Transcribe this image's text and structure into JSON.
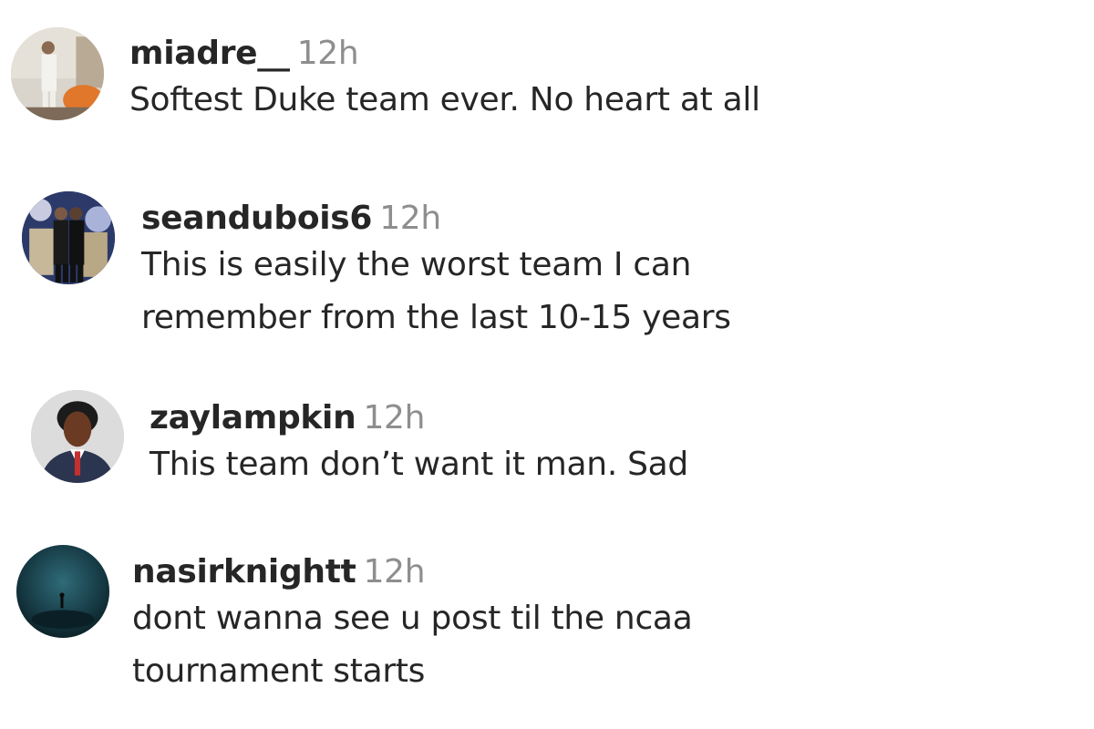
{
  "comments": [
    {
      "username": "miadre__",
      "time": "12h",
      "text": "Softest Duke team ever. No heart at all",
      "avatar_icon": "profile-photo"
    },
    {
      "username": "seandubois6",
      "time": "12h",
      "text": "This is easily the worst team I can remember from the last 10-15 years",
      "avatar_icon": "profile-photo"
    },
    {
      "username": "zaylampkin",
      "time": "12h",
      "text": "This team don’t want it man. Sad",
      "avatar_icon": "profile-photo"
    },
    {
      "username": "nasirknightt",
      "time": "12h",
      "text": "dont wanna see u post til the ncaa tournament starts",
      "avatar_icon": "profile-photo"
    }
  ],
  "colors": {
    "username": "#262626",
    "time": "#8e8e8e",
    "body": "#262626",
    "background": "#ffffff"
  }
}
